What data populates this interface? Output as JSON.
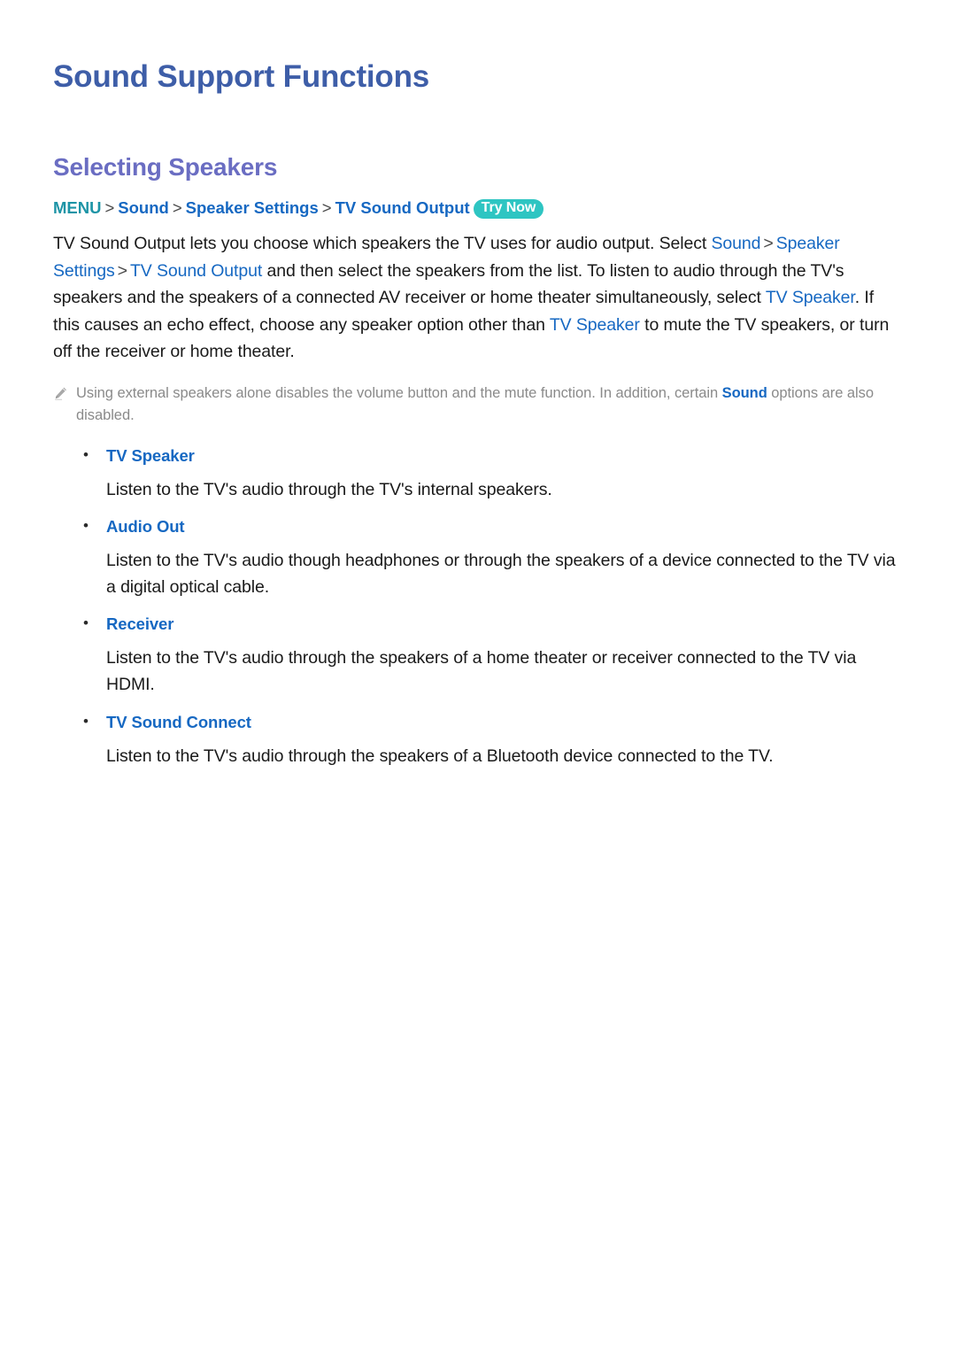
{
  "document": {
    "page_title": "Sound Support Functions",
    "section_title": "Selecting Speakers"
  },
  "breadcrumb": {
    "menu_label": "MENU",
    "separator": ">",
    "items": [
      {
        "label": "Sound"
      },
      {
        "label": "Speaker Settings"
      },
      {
        "label": "TV Sound Output"
      }
    ],
    "badge": "Try Now"
  },
  "body": {
    "p1_part1": "TV Sound Output lets you choose which speakers the TV uses for audio output. Select ",
    "p1_link1": "Sound",
    "p1_link2": "Speaker Settings",
    "p1_link3": "TV Sound Output",
    "p1_part2": " and then select the speakers from the list. To listen to audio through the TV's speakers and the speakers of a connected AV receiver or home theater simultaneously, select ",
    "p1_link4": "TV Speaker",
    "p1_part3": ". If this causes an echo effect, choose any speaker option other than ",
    "p1_link5": "TV Speaker",
    "p1_part4": " to mute the TV speakers, or turn off the receiver or home theater."
  },
  "note": {
    "icon": "pencil-icon",
    "text_part1": "Using external speakers alone disables the volume button and the mute function. In addition, certain ",
    "link": "Sound",
    "text_part2": " options are also disabled."
  },
  "options": [
    {
      "label": "TV Speaker",
      "description": "Listen to the TV's audio through the TV's internal speakers."
    },
    {
      "label": "Audio Out",
      "description": "Listen to the TV's audio though headphones or through the speakers of a device connected to the TV via a digital optical cable."
    },
    {
      "label": "Receiver",
      "description": "Listen to the TV's audio through the speakers of a home theater or receiver connected to the TV via HDMI."
    },
    {
      "label": "TV Sound Connect",
      "description": "Listen to the TV's audio through the speakers of a Bluetooth device connected to the TV."
    }
  ],
  "colors": {
    "page_title": "#3e5ea8",
    "section_title": "#6a6dc2",
    "link": "#1668c2",
    "menu_teal": "#1d94a6",
    "badge_bg": "#2ec5c2",
    "note_text": "#8a8a8a",
    "body_text": "#1a1a1a"
  }
}
